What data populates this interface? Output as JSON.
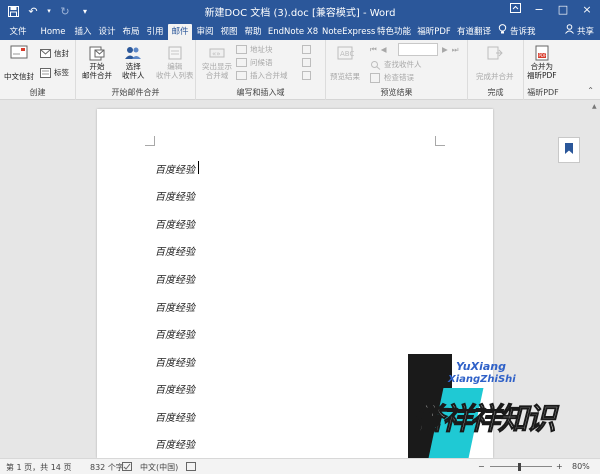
{
  "window": {
    "title": "新建DOC 文档 (3).doc [兼容模式] - Word"
  },
  "tabs": [
    {
      "label": "文件"
    },
    {
      "label": "Home"
    },
    {
      "label": "插入"
    },
    {
      "label": "设计"
    },
    {
      "label": "布局"
    },
    {
      "label": "引用"
    },
    {
      "label": "邮件",
      "active": true
    },
    {
      "label": "审阅"
    },
    {
      "label": "视图"
    },
    {
      "label": "帮助"
    },
    {
      "label": "EndNote X8"
    },
    {
      "label": "NoteExpress"
    },
    {
      "label": "特色功能"
    },
    {
      "label": "福昕PDF"
    },
    {
      "label": "有道翻译"
    }
  ],
  "tell_me": "告诉我",
  "share": "共享",
  "ribbon": {
    "create": {
      "label": "创建",
      "chinese_envelope": "中文信封",
      "envelope": "信封",
      "labels": "标签"
    },
    "start_merge": {
      "label": "开始邮件合并",
      "start": "开始",
      "start2": "邮件合并",
      "select": "选择",
      "select2": "收件人",
      "edit": "编辑",
      "edit2": "收件人列表"
    },
    "write_insert": {
      "label": "编写和插入域",
      "highlight": "突出显示",
      "highlight2": "合并域",
      "address_block": "地址块",
      "greeting": "问候语",
      "insert_field": "插入合并域"
    },
    "preview": {
      "label": "预览结果",
      "preview_results": "预览结果",
      "find_recipient": "查找收件人",
      "check_errors": "检查错误"
    },
    "finish": {
      "label": "完成",
      "finish_merge": "完成并合并"
    },
    "foxit": {
      "label": "福昕PDF",
      "merge_pdf": "合并为",
      "merge_pdf2": "福昕PDF"
    }
  },
  "document": {
    "lines": [
      "百度经验",
      "百度经验",
      "百度经验",
      "百度经验",
      "百度经验",
      "百度经验",
      "百度经验",
      "百度经验",
      "百度经验",
      "百度经验",
      "百度经验"
    ]
  },
  "watermark": {
    "en1": "YuXiang",
    "en2": "XiangZhiShi",
    "zh": "誉祥祥知识"
  },
  "status": {
    "page": "第 1 页，共 14 页",
    "words": "832 个字",
    "language": "中文(中国)",
    "zoom": "80%"
  },
  "colors": {
    "accent": "#2b579a",
    "watermark_teal": "#1fc9d4",
    "watermark_blue": "#2f61c8"
  }
}
